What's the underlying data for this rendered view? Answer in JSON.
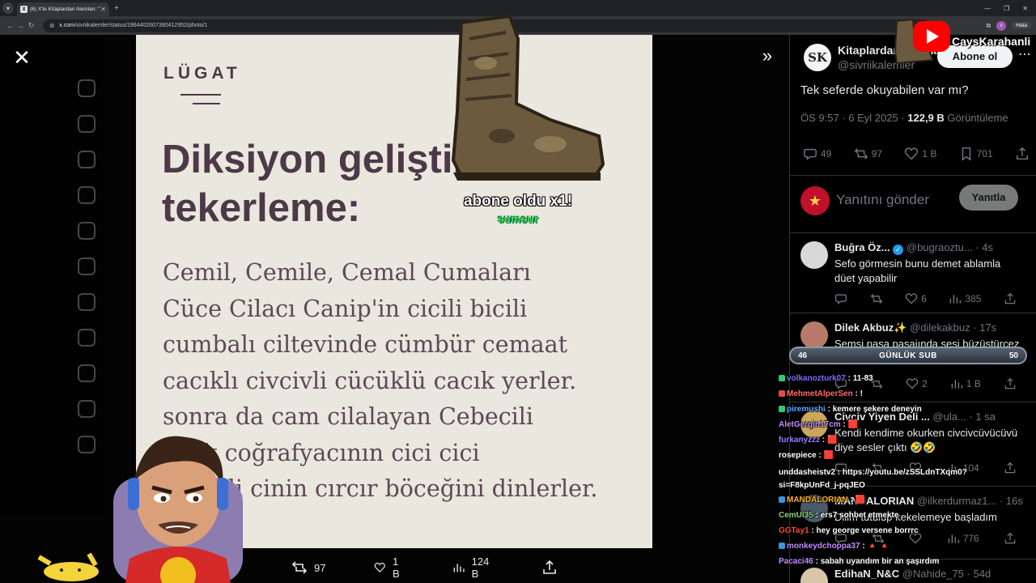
{
  "browser": {
    "tab_title": "(6) X'te Kitaplardan Alemlan: \"Te",
    "url_domain": "x.com",
    "url_path": "/sivriikalemler/status/1964402607390412952/photo/1",
    "profile_initial": "c",
    "error_label": "Hata"
  },
  "photo": {
    "brand": "LÜGAT",
    "heading": "Diksiyon geliştirme\ntekerleme:",
    "poem": [
      "Cemil, Cemile, Cemal Cumaları",
      "Cüce Cilacı Canip'in cicili bicili",
      "cumbalı ciltevinde cümbür cemaat",
      "cacıklı civcivli cücüklü cacık yerler.",
      "sonra da cam cilalayan Cebecili",
      "cıvık coğrafyacının cici cici",
      "cezveli cinin cırcır böceğini dinlerler."
    ]
  },
  "overlay": {
    "alert_text": "abone oldu x1!",
    "alert_user": "sumsur",
    "channel_name": "CaysKarahanli"
  },
  "photo_actions": {
    "retweets": "97",
    "likes": "1 B",
    "views": "124 B"
  },
  "panel": {
    "author_name": "Kitaplardan Alemlan",
    "author_handle": "@sivriikalemler",
    "avatar_text": "SK",
    "follow_label": "Abone ol",
    "tweet_text": "Tek seferde okuyabilen var mı?",
    "time": "ÖS 9:57 · 6 Eyl 2025 ·",
    "views_count": "122,9 B",
    "views_label": "Görüntüleme",
    "counts": {
      "replies": "49",
      "retweets": "97",
      "likes": "1 B",
      "bookmarks": "701"
    },
    "reply_placeholder": "Yanıtını gönder",
    "reply_button": "Yanıtla"
  },
  "replies": [
    {
      "name": "Buğra Öz...",
      "handle": "@bugraoztu...",
      "time": "· 4s",
      "verified": true,
      "text": "Sefo görmesin  bunu demet ablamla düet yapabilir",
      "likes": "6",
      "views": "385"
    },
    {
      "name": "Dilek Akbuz✨",
      "handle": "@dilekakbuz",
      "time": "· 17s",
      "verified": false,
      "text": "Şemsi paşa pasajında sesi büzüştürcez 😅",
      "likes": "2",
      "views": "1 B"
    },
    {
      "name": "Civciv Yiyen Deli ...",
      "handle": "@ula...",
      "time": "· 1 sa",
      "verified": false,
      "text": "Kendi kendime okurken civcivcüvücüvü diye sesler çıktı 🤣🤣",
      "likes": "",
      "views": "104"
    },
    {
      "name": "MANDALORIAN",
      "handle": "@ilkerdurmaz1...",
      "time": "· 16s",
      "verified": false,
      "text": "Dilim tutulup kekelemeye başladım",
      "likes": "",
      "views": "776"
    },
    {
      "name": "EdihaN_N&C",
      "handle": "@Nahide_75",
      "time": "· 54d",
      "verified": false,
      "text": "",
      "likes": "",
      "views": ""
    }
  ],
  "subbar": {
    "left": "46",
    "label": "GÜNLÜK SUB",
    "right": "50"
  },
  "chat": [
    {
      "user": "volkanozturk07",
      "color": "#7b6cff",
      "msg": "11-83"
    },
    {
      "user": "MehmetAlperSen",
      "color": "#ff6b6b",
      "msg": "!"
    },
    {
      "user": "piremushi",
      "color": "#5aa7ff",
      "msg": "kemere şekere deneyin"
    },
    {
      "user": "AletGergin17cm",
      "color": "#c28bff",
      "msg": "🟥"
    },
    {
      "user": "furkanyzzz",
      "color": "#9a7bff",
      "msg": "🟥"
    },
    {
      "user": "rosepiece",
      "color": "#ffffff",
      "msg": "🟥"
    },
    {
      "user": "unddasheistv2",
      "color": "#ffffff",
      "msg": "https://youtu.be/zSSLdnTXqm0?si=F8kpUnFd_j-pqJEO"
    },
    {
      "user": "MANDALORIAN",
      "color": "#ffb020",
      "msg": "🟥"
    },
    {
      "user": "CemUl35",
      "color": "#8bd17c",
      "msg": "ers7 sohbet etmekte"
    },
    {
      "user": "GGTay1",
      "color": "#ff4444",
      "msg": "hey george versene borrrc"
    },
    {
      "user": "monkeydchoppa37",
      "color": "#c28bff",
      "msg": "🔺 🔺"
    },
    {
      "user": "Pacaci46",
      "color": "#c28bff",
      "msg": "sabah uyandım bir an şaşırdım"
    }
  ]
}
